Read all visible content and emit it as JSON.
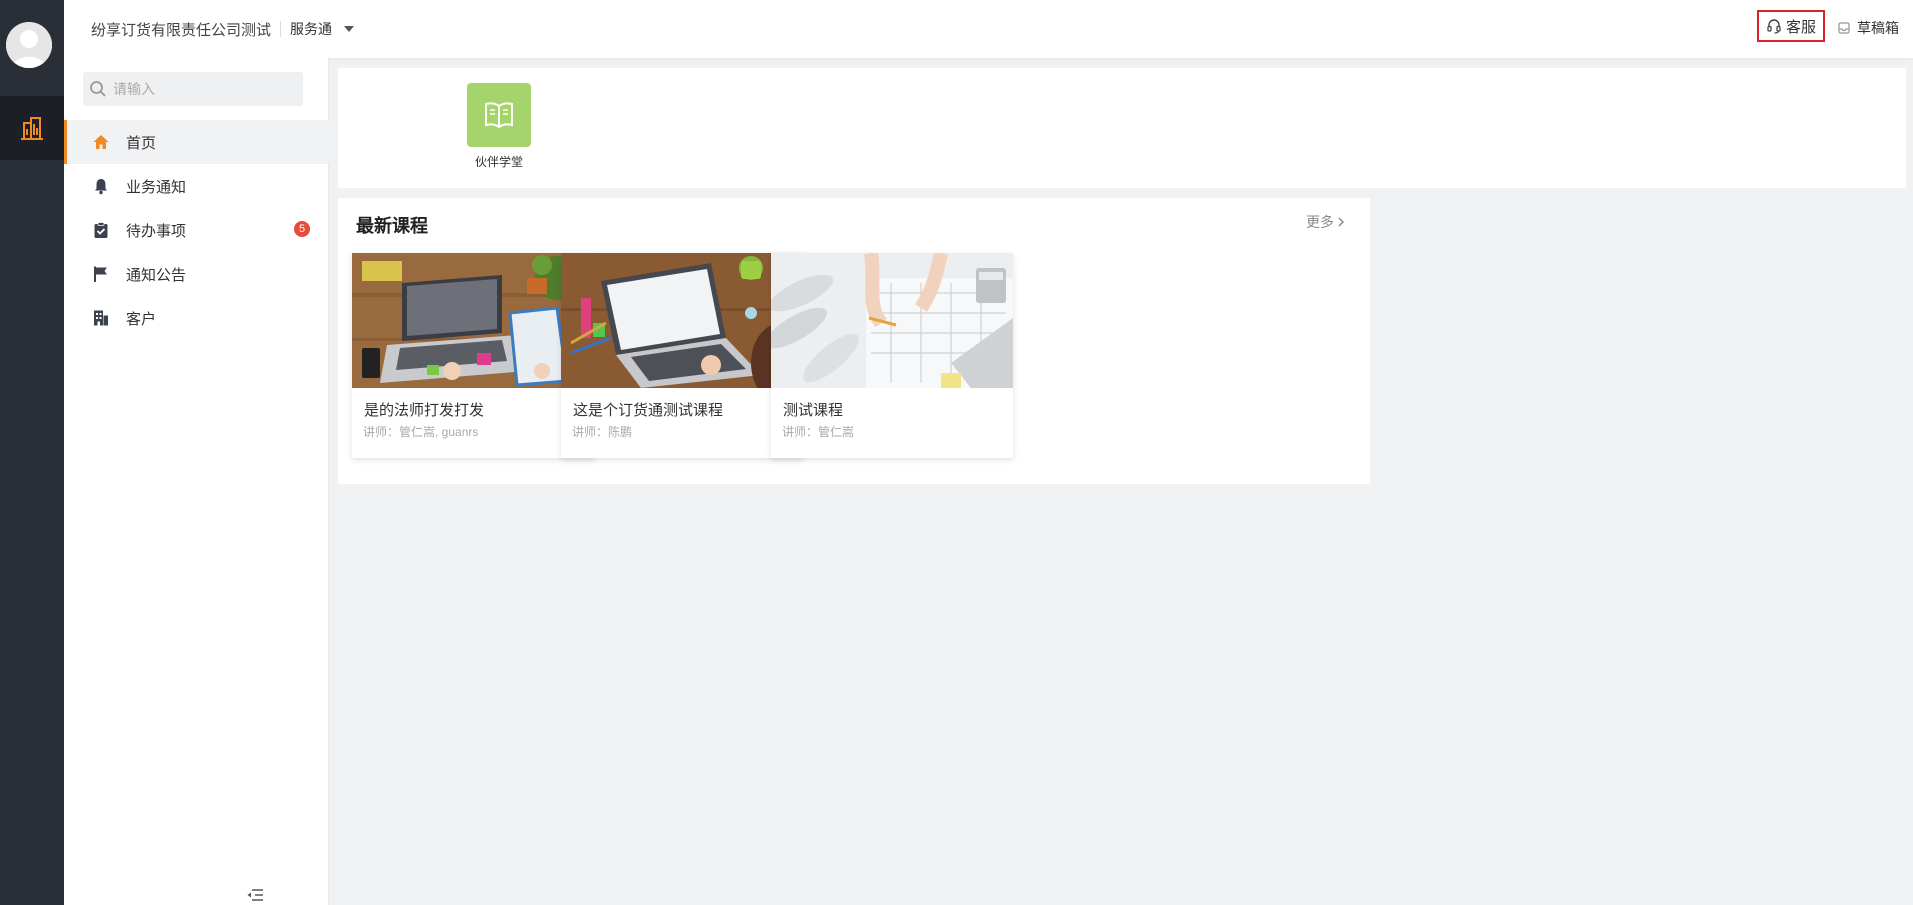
{
  "colors": {
    "rail_bg": "#2a2e37",
    "accent": "#f08a24",
    "badge": "#e64b3c",
    "highlight_border": "#d9232e",
    "quick_icon_bg": "#a5d46d"
  },
  "header": {
    "company": "纷享订货有限责任公司测试",
    "product": "服务通",
    "customer_service": "客服",
    "drafts": "草稿箱"
  },
  "rail": {
    "avatar_icon": "avatar-icon",
    "active_icon": "building-chart-icon"
  },
  "search": {
    "placeholder": "请输入",
    "value": ""
  },
  "menu": [
    {
      "label": "首页",
      "icon": "home-icon",
      "active": true
    },
    {
      "label": "业务通知",
      "icon": "bell-icon"
    },
    {
      "label": "待办事项",
      "icon": "clipboard-check-icon",
      "badge": "5"
    },
    {
      "label": "通知公告",
      "icon": "flag-icon"
    },
    {
      "label": "客户",
      "icon": "building-icon"
    }
  ],
  "quick_links": [
    {
      "label": "伙伴学堂",
      "icon": "open-book-icon"
    }
  ],
  "courses": {
    "title": "最新课程",
    "more": "更多",
    "items": [
      {
        "name": "是的法师打发打发",
        "teacher": "讲师：管仁嵩, guanrs"
      },
      {
        "name": "这是个订货通测试课程",
        "teacher": "讲师：陈鹏"
      },
      {
        "name": "测试课程",
        "teacher": "讲师：管仁嵩"
      }
    ]
  }
}
